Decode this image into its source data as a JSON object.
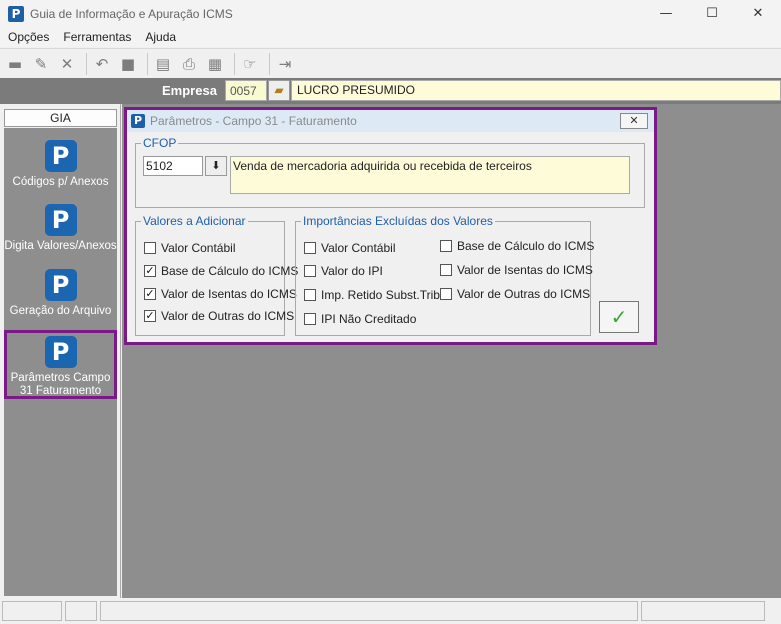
{
  "window": {
    "title": "Guia de Informação e Apuração ICMS",
    "minimize": "—",
    "maximize": "☐",
    "close": "✕"
  },
  "menu": [
    "Opções",
    "Ferramentas",
    "Ajuda"
  ],
  "empresa": {
    "label": "Empresa",
    "code": "0057",
    "name": "LUCRO PRESUMIDO"
  },
  "sidebar": {
    "tab": "GIA",
    "items": [
      {
        "label": "Códigos p/ Anexos"
      },
      {
        "label": "Digita Valores/Anexos"
      },
      {
        "label": "Geração do Arquivo"
      },
      {
        "label": "Parâmetros Campo 31 Faturamento"
      }
    ]
  },
  "dialog": {
    "title": "Parâmetros - Campo 31 - Faturamento",
    "cfop_legend": "CFOP",
    "cfop_value": "5102",
    "cfop_description": "Venda de mercadoria adquirida ou recebida de terceiros",
    "valores_legend": "Valores a Adicionar",
    "valores": [
      {
        "label": "Valor Contábil",
        "checked": false
      },
      {
        "label": "Base de Cálculo do ICMS",
        "checked": true
      },
      {
        "label": "Valor de Isentas do ICMS",
        "checked": true
      },
      {
        "label": "Valor de Outras do ICMS",
        "checked": true
      }
    ],
    "excluidas_legend": "Importâncias Excluídas dos Valores",
    "excluidas": [
      {
        "label": "Valor Contábil",
        "checked": false
      },
      {
        "label": "Valor do IPI",
        "checked": false
      },
      {
        "label": "Imp. Retido Subst.Trib.",
        "checked": false
      },
      {
        "label": "IPI Não Creditado",
        "checked": false
      },
      {
        "label": "Base de Cálculo do ICMS",
        "checked": false
      },
      {
        "label": "Valor de Isentas do ICMS",
        "checked": false
      },
      {
        "label": "Valor de Outras do ICMS",
        "checked": false
      }
    ]
  }
}
